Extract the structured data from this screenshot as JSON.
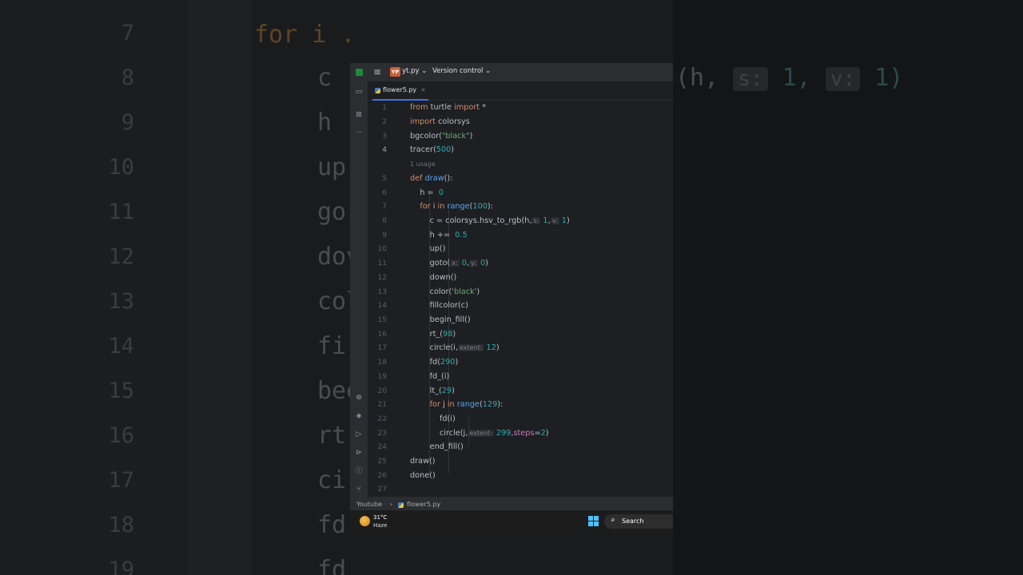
{
  "background": {
    "line_numbers": [
      "7",
      "8",
      "9",
      "10",
      "11",
      "12",
      "13",
      "14",
      "15",
      "16",
      "17",
      "18",
      "19"
    ],
    "code_fragments": [
      "c",
      "h",
      "up",
      "go",
      "dov",
      "col",
      "fi",
      "bee",
      "rt",
      "ci",
      "fd",
      "fd"
    ],
    "top_keyword": "for i .",
    "right_call": {
      "prefix": "(h,",
      "s_hint": "s:",
      "s_val": "1,",
      "v_hint": "v:",
      "v_val": "1)"
    }
  },
  "titlebar": {
    "project_badge": "YP",
    "project_name": "yt.py",
    "version_control": "Version control"
  },
  "tab": {
    "filename": "flower5.py",
    "close": "×"
  },
  "editor": {
    "current_line": "4",
    "usage_hint": "1 usage",
    "lines": [
      "1",
      "2",
      "3",
      "4",
      "5",
      "6",
      "7",
      "8",
      "9",
      "10",
      "11",
      "12",
      "13",
      "14",
      "15",
      "16",
      "17",
      "18",
      "19",
      "20",
      "21",
      "22",
      "23",
      "24",
      "25",
      "26",
      "27"
    ]
  },
  "statusbar": {
    "project": "Youtube",
    "file": "flower5.py"
  },
  "taskbar": {
    "temperature": "31°C",
    "condition": "Haze",
    "search": "Search"
  },
  "colors": {
    "accent": "#3574f0",
    "keyword": "#cf8e6d",
    "function": "#56a8f5",
    "number": "#2aacb8",
    "string": "#6aab73"
  }
}
